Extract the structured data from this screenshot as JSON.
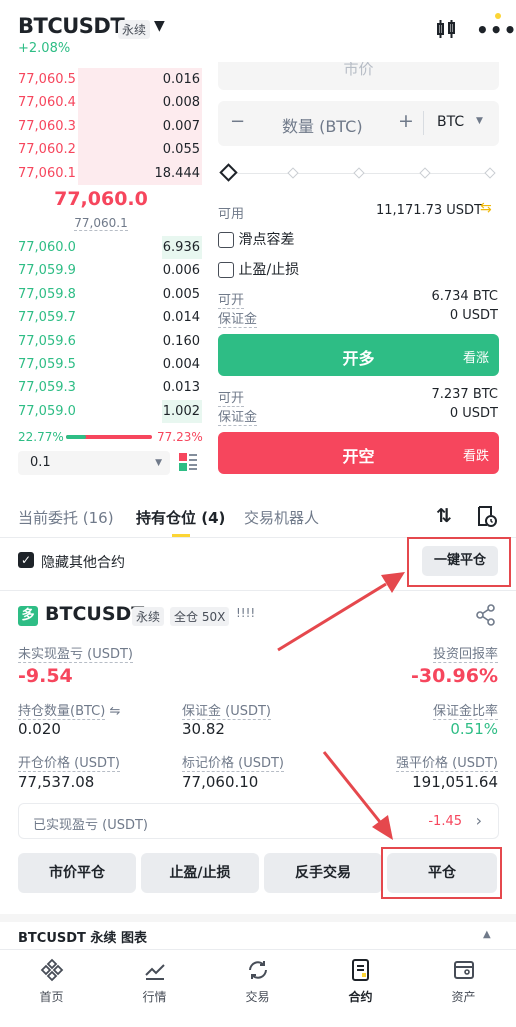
{
  "header": {
    "symbol": "BTCUSDT",
    "badge": "永续",
    "change": "+2.08%"
  },
  "orderbook": {
    "asks": [
      {
        "price": "77,060.5",
        "qty": "0.016"
      },
      {
        "price": "77,060.4",
        "qty": "0.008"
      },
      {
        "price": "77,060.3",
        "qty": "0.007"
      },
      {
        "price": "77,060.2",
        "qty": "0.055"
      },
      {
        "price": "77,060.1",
        "qty": "18.444"
      }
    ],
    "last_price": "77,060.0",
    "mark_price": "77,060.1",
    "bids": [
      {
        "price": "77,060.0",
        "qty": "6.936"
      },
      {
        "price": "77,059.9",
        "qty": "0.006"
      },
      {
        "price": "77,059.8",
        "qty": "0.005"
      },
      {
        "price": "77,059.7",
        "qty": "0.014"
      },
      {
        "price": "77,059.6",
        "qty": "0.160"
      },
      {
        "price": "77,059.5",
        "qty": "0.004"
      },
      {
        "price": "77,059.3",
        "qty": "0.013"
      },
      {
        "price": "77,059.0",
        "qty": "1.002"
      }
    ],
    "bid_ratio": "22.77%",
    "ask_ratio": "77.23%",
    "bid_ratio_value": 22.77,
    "precision": "0.1"
  },
  "order_form": {
    "price_placeholder": "市价",
    "qty_placeholder": "数量 (BTC)",
    "unit": "BTC",
    "minus": "−",
    "plus": "+",
    "available_label": "可用",
    "available_value": "11,171.73 USDT",
    "slippage_label": "滑点容差",
    "tpsl_label": "止盈/止损",
    "long": {
      "open_label": "可开",
      "open_value": "6.734 BTC",
      "margin_label": "保证金",
      "margin_value": "0 USDT",
      "button": "开多",
      "hint": "看涨"
    },
    "short": {
      "open_label": "可开",
      "open_value": "7.237 BTC",
      "margin_label": "保证金",
      "margin_value": "0 USDT",
      "button": "开空",
      "hint": "看跌"
    }
  },
  "tabs": [
    "当前委托 (16)",
    "持有仓位 (4)",
    "交易机器人"
  ],
  "positions": {
    "hide_label": "隐藏其他合约",
    "close_all": "一键平仓",
    "card": {
      "symbol": "BTCUSDT",
      "perp": "永续",
      "mode": "全仓 50X",
      "bars": "!!!!",
      "upnl_label": "未实现盈亏 (USDT)",
      "upnl": "-9.54",
      "roe_label": "投资回报率",
      "roe": "-30.96%",
      "size_label": "持仓数量(BTC)",
      "size": "0.020",
      "margin_label": "保证金 (USDT)",
      "margin": "30.82",
      "ratio_label": "保证金比率",
      "ratio": "0.51%",
      "entry_label": "开仓价格 (USDT)",
      "entry": "77,537.08",
      "mark_label": "标记价格 (USDT)",
      "mark": "77,060.10",
      "liq_label": "强平价格 (USDT)",
      "liq": "191,051.64",
      "realized_label": "已实现盈亏 (USDT)",
      "realized": "-1.45",
      "actions": [
        "市价平仓",
        "止盈/止损",
        "反手交易",
        "平仓"
      ]
    }
  },
  "chart_bar": {
    "label": "BTCUSDT 永续 图表"
  },
  "nav": [
    "首页",
    "行情",
    "交易",
    "合约",
    "资产"
  ],
  "colors": {
    "green": "#2ebd85",
    "red": "#f6465d",
    "highlight": "#e5484d",
    "yellow": "#fcd535"
  }
}
